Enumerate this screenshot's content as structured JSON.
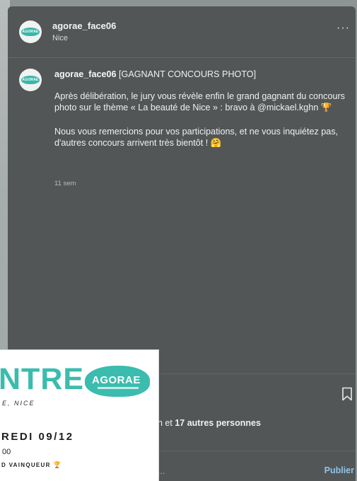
{
  "header": {
    "username": "agorae_face06",
    "location": "Nice",
    "more_label": "···",
    "avatar_text": "AGORAE"
  },
  "caption": {
    "username": "agorae_face06",
    "title": " [GAGNANT CONCOURS PHOTO]",
    "paragraph1": "Après délibération, le jury vous révèle enfin le grand gagnant du concours photo sur le thème « La beauté de Nice » : bravo à @mickael.kghn 🏆",
    "paragraph2": "Nous vous remercions pour vos participations,  et ne vous inquiétez pas, d'autres concours arrivent très bientôt ! 🤗",
    "time": "11 sem"
  },
  "likes": {
    "prefix": "n et ",
    "count": "17 autres personnes"
  },
  "comment": {
    "placeholder": "...",
    "publish_label": "Publier"
  },
  "poster": {
    "title": "NTRE",
    "subtitle": "E, NICE",
    "logo": "AGORAE",
    "date": "REDI 09/12",
    "hour": "00",
    "winner": "D VAINQUEUR",
    "trophy": "🏆"
  },
  "colors": {
    "panel": "#535656",
    "accent_teal": "#3bbcae",
    "publish_blue": "#8ec4e8"
  }
}
